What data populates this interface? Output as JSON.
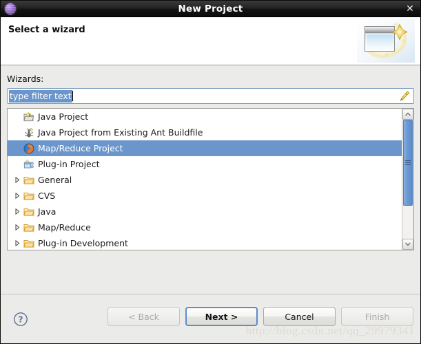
{
  "window": {
    "title": "New Project",
    "app_icon": "eclipse-globe-icon",
    "close_label": "✕"
  },
  "header": {
    "title": "Select a wizard",
    "icon": "wizard-banner-icon"
  },
  "form": {
    "wizards_label": "Wizards:",
    "filter": {
      "value": "type filter text",
      "placeholder": "type filter text",
      "selected": true,
      "clear_icon": "broom-icon"
    }
  },
  "tree": {
    "items": [
      {
        "label": "Java Project",
        "icon": "java-project-icon",
        "expandable": false,
        "selected": false,
        "indent": 1
      },
      {
        "label": "Java Project from Existing Ant Buildfile",
        "icon": "ant-buildfile-icon",
        "expandable": false,
        "selected": false,
        "indent": 1
      },
      {
        "label": "Map/Reduce Project",
        "icon": "map-reduce-icon",
        "expandable": false,
        "selected": true,
        "indent": 1
      },
      {
        "label": "Plug-in Project",
        "icon": "plugin-project-icon",
        "expandable": false,
        "selected": false,
        "indent": 1
      },
      {
        "label": "General",
        "icon": "folder-icon",
        "expandable": true,
        "selected": false,
        "indent": 0
      },
      {
        "label": "CVS",
        "icon": "folder-icon",
        "expandable": true,
        "selected": false,
        "indent": 0
      },
      {
        "label": "Java",
        "icon": "folder-icon",
        "expandable": true,
        "selected": false,
        "indent": 0
      },
      {
        "label": "Map/Reduce",
        "icon": "folder-icon",
        "expandable": true,
        "selected": false,
        "indent": 0
      },
      {
        "label": "Plug-in Development",
        "icon": "folder-icon",
        "expandable": true,
        "selected": false,
        "indent": 0
      }
    ],
    "scrollbar": {
      "up_arrow": "chevron-up-icon",
      "down_arrow": "chevron-down-icon",
      "thumb_position_percent": 0,
      "thumb_size_percent": 72
    }
  },
  "footer": {
    "help_icon": "help-question-icon",
    "buttons": [
      {
        "label": "< Back",
        "state": "disabled"
      },
      {
        "label": "Next >",
        "state": "default"
      },
      {
        "label": "Cancel",
        "state": "normal"
      },
      {
        "label": "Finish",
        "state": "disabled"
      }
    ]
  },
  "watermark": {
    "text": "http://blog.csdn.net/qq_29979341"
  },
  "colors": {
    "selection": "#6b96cc",
    "dialog_bg": "#ebebe9",
    "titlebar_bg": "#141414",
    "accent_border": "#5b8ccb"
  }
}
